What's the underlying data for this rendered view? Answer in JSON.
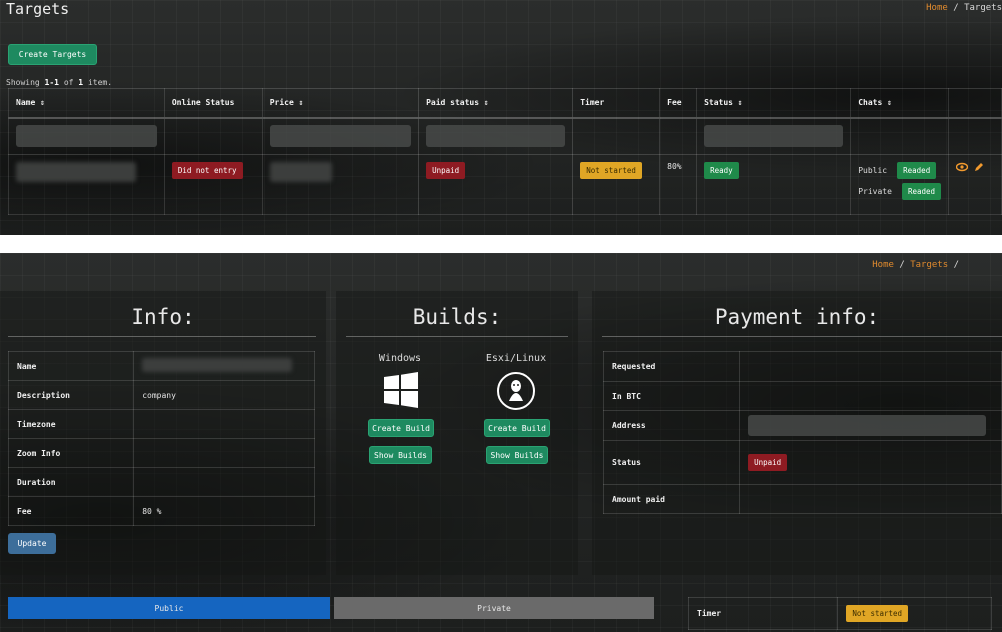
{
  "top": {
    "title": "Targets",
    "breadcrumb": {
      "home": "Home",
      "sep": "/",
      "current": "Targets"
    },
    "create_button": "Create Targets",
    "summary": {
      "prefix": "Showing",
      "range": "1-1",
      "of": "of",
      "total": "1",
      "suffix": "item."
    },
    "columns": [
      "Name ⇕",
      "Online Status",
      "Price ⇕",
      "Paid status ⇕",
      "Timer",
      "Fee",
      "Status ⇕",
      "Chats ⇕",
      ""
    ],
    "row": {
      "online_status": "Did not entry",
      "paid_status": "Unpaid",
      "timer": "Not started",
      "fee": "80%",
      "status": "Ready",
      "chats": [
        {
          "label": "Public",
          "state": "Readed"
        },
        {
          "label": "Private",
          "state": "Readed"
        }
      ]
    }
  },
  "bottom": {
    "breadcrumb": {
      "home": "Home",
      "sep": "/",
      "current": "Targets",
      "trail": "/"
    },
    "info": {
      "title": "Info:",
      "rows": [
        {
          "key": "Name",
          "value": ""
        },
        {
          "key": "Description",
          "value": "company"
        },
        {
          "key": "Timezone",
          "value": ""
        },
        {
          "key": "Zoom Info",
          "value": ""
        },
        {
          "key": "Duration",
          "value": ""
        },
        {
          "key": "Fee",
          "value": "80 %"
        }
      ],
      "update_button": "Update"
    },
    "builds": {
      "title": "Builds:",
      "windows_label": "Windows",
      "linux_label": "Esxi/Linux",
      "create_build": "Create Build",
      "show_builds": "Show Builds"
    },
    "payment": {
      "title": "Payment info:",
      "rows": [
        {
          "key": "Requested",
          "value": ""
        },
        {
          "key": "In BTC",
          "value": ""
        },
        {
          "key": "Address",
          "value": ""
        },
        {
          "key": "Status",
          "value": "Unpaid"
        },
        {
          "key": "Amount paid",
          "value": ""
        }
      ]
    },
    "tabs": {
      "public": "Public",
      "private": "Private"
    },
    "timer": {
      "label": "Timer",
      "value": "Not started"
    }
  },
  "colors": {
    "accent": "#e08a2e",
    "green": "#1e8a60",
    "red": "#8e1b22",
    "yellow": "#e0a625",
    "blue": "#1565c0"
  }
}
